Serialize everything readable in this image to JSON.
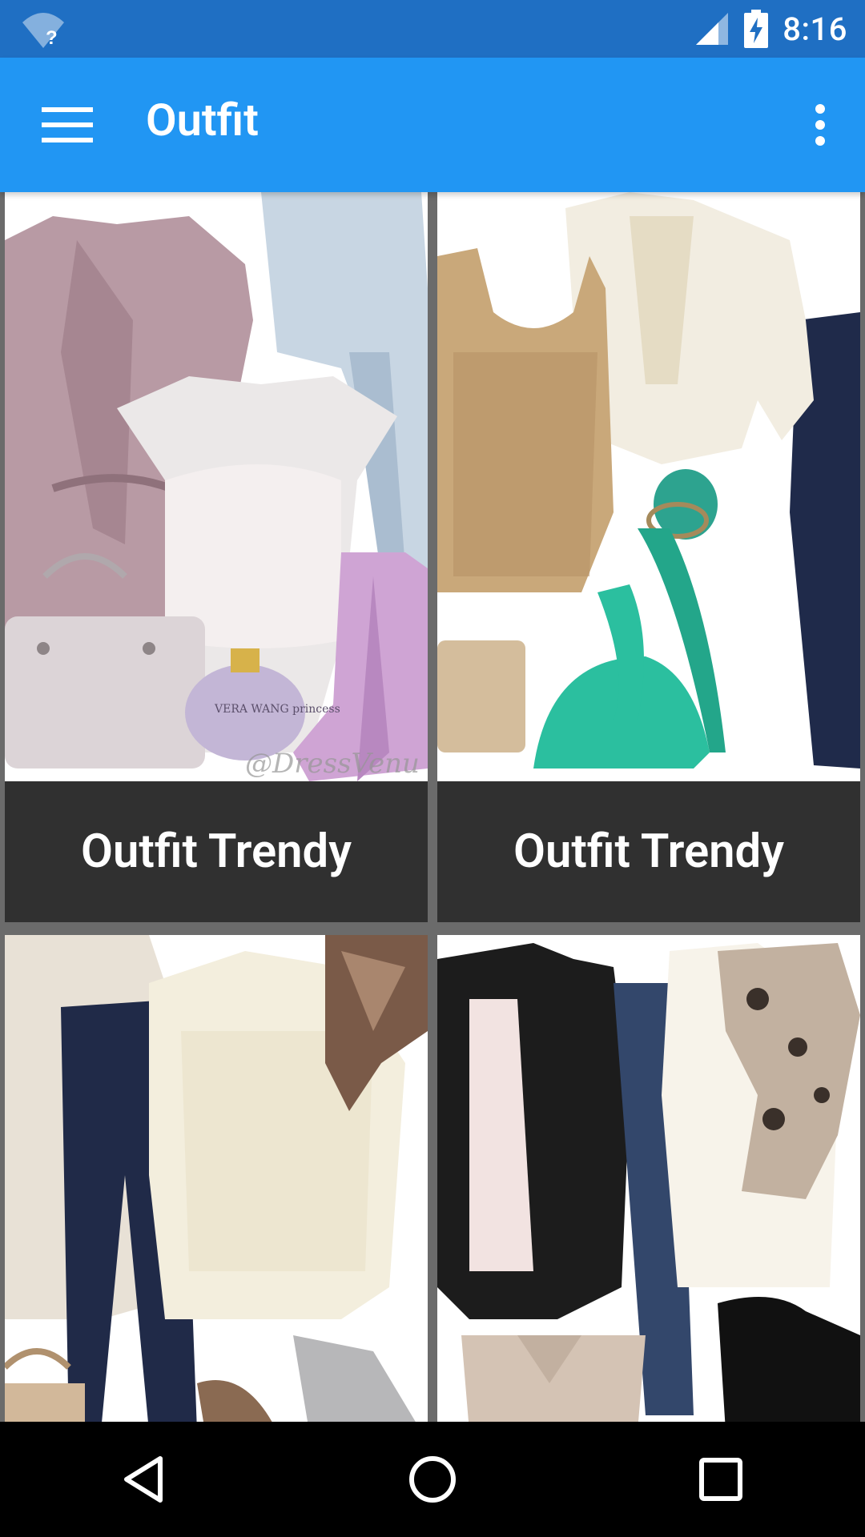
{
  "status_bar": {
    "time": "8:16",
    "icons": [
      "wifi-question-icon",
      "signal-icon",
      "battery-charging-icon"
    ],
    "wifi_badge": "?"
  },
  "app_bar": {
    "title": "Outfit",
    "menu_icon": "hamburger-menu-icon",
    "overflow_icon": "more-vert-icon",
    "color": "#2196f3",
    "status_color": "#1f6fc3"
  },
  "cards": [
    {
      "caption": "Outfit Trendy",
      "image": "outfit-1-mauve-coat-lace-top",
      "watermark": "@DressVenu",
      "perfume_label": "VERA WANG princess"
    },
    {
      "caption": "Outfit Trendy",
      "image": "outfit-2-cream-blazer-sequin-tank"
    },
    {
      "caption": "",
      "image": "outfit-3-lace-top-jeans-scarf"
    },
    {
      "caption": "",
      "image": "outfit-4-black-blazer-leopard-scarf"
    }
  ],
  "nav_bar": {
    "icons": [
      "back-icon",
      "home-icon",
      "recents-icon"
    ]
  },
  "colors": {
    "caption_bg": "#303030",
    "divider": "#6b6b6b",
    "nav_bg": "#000000"
  }
}
